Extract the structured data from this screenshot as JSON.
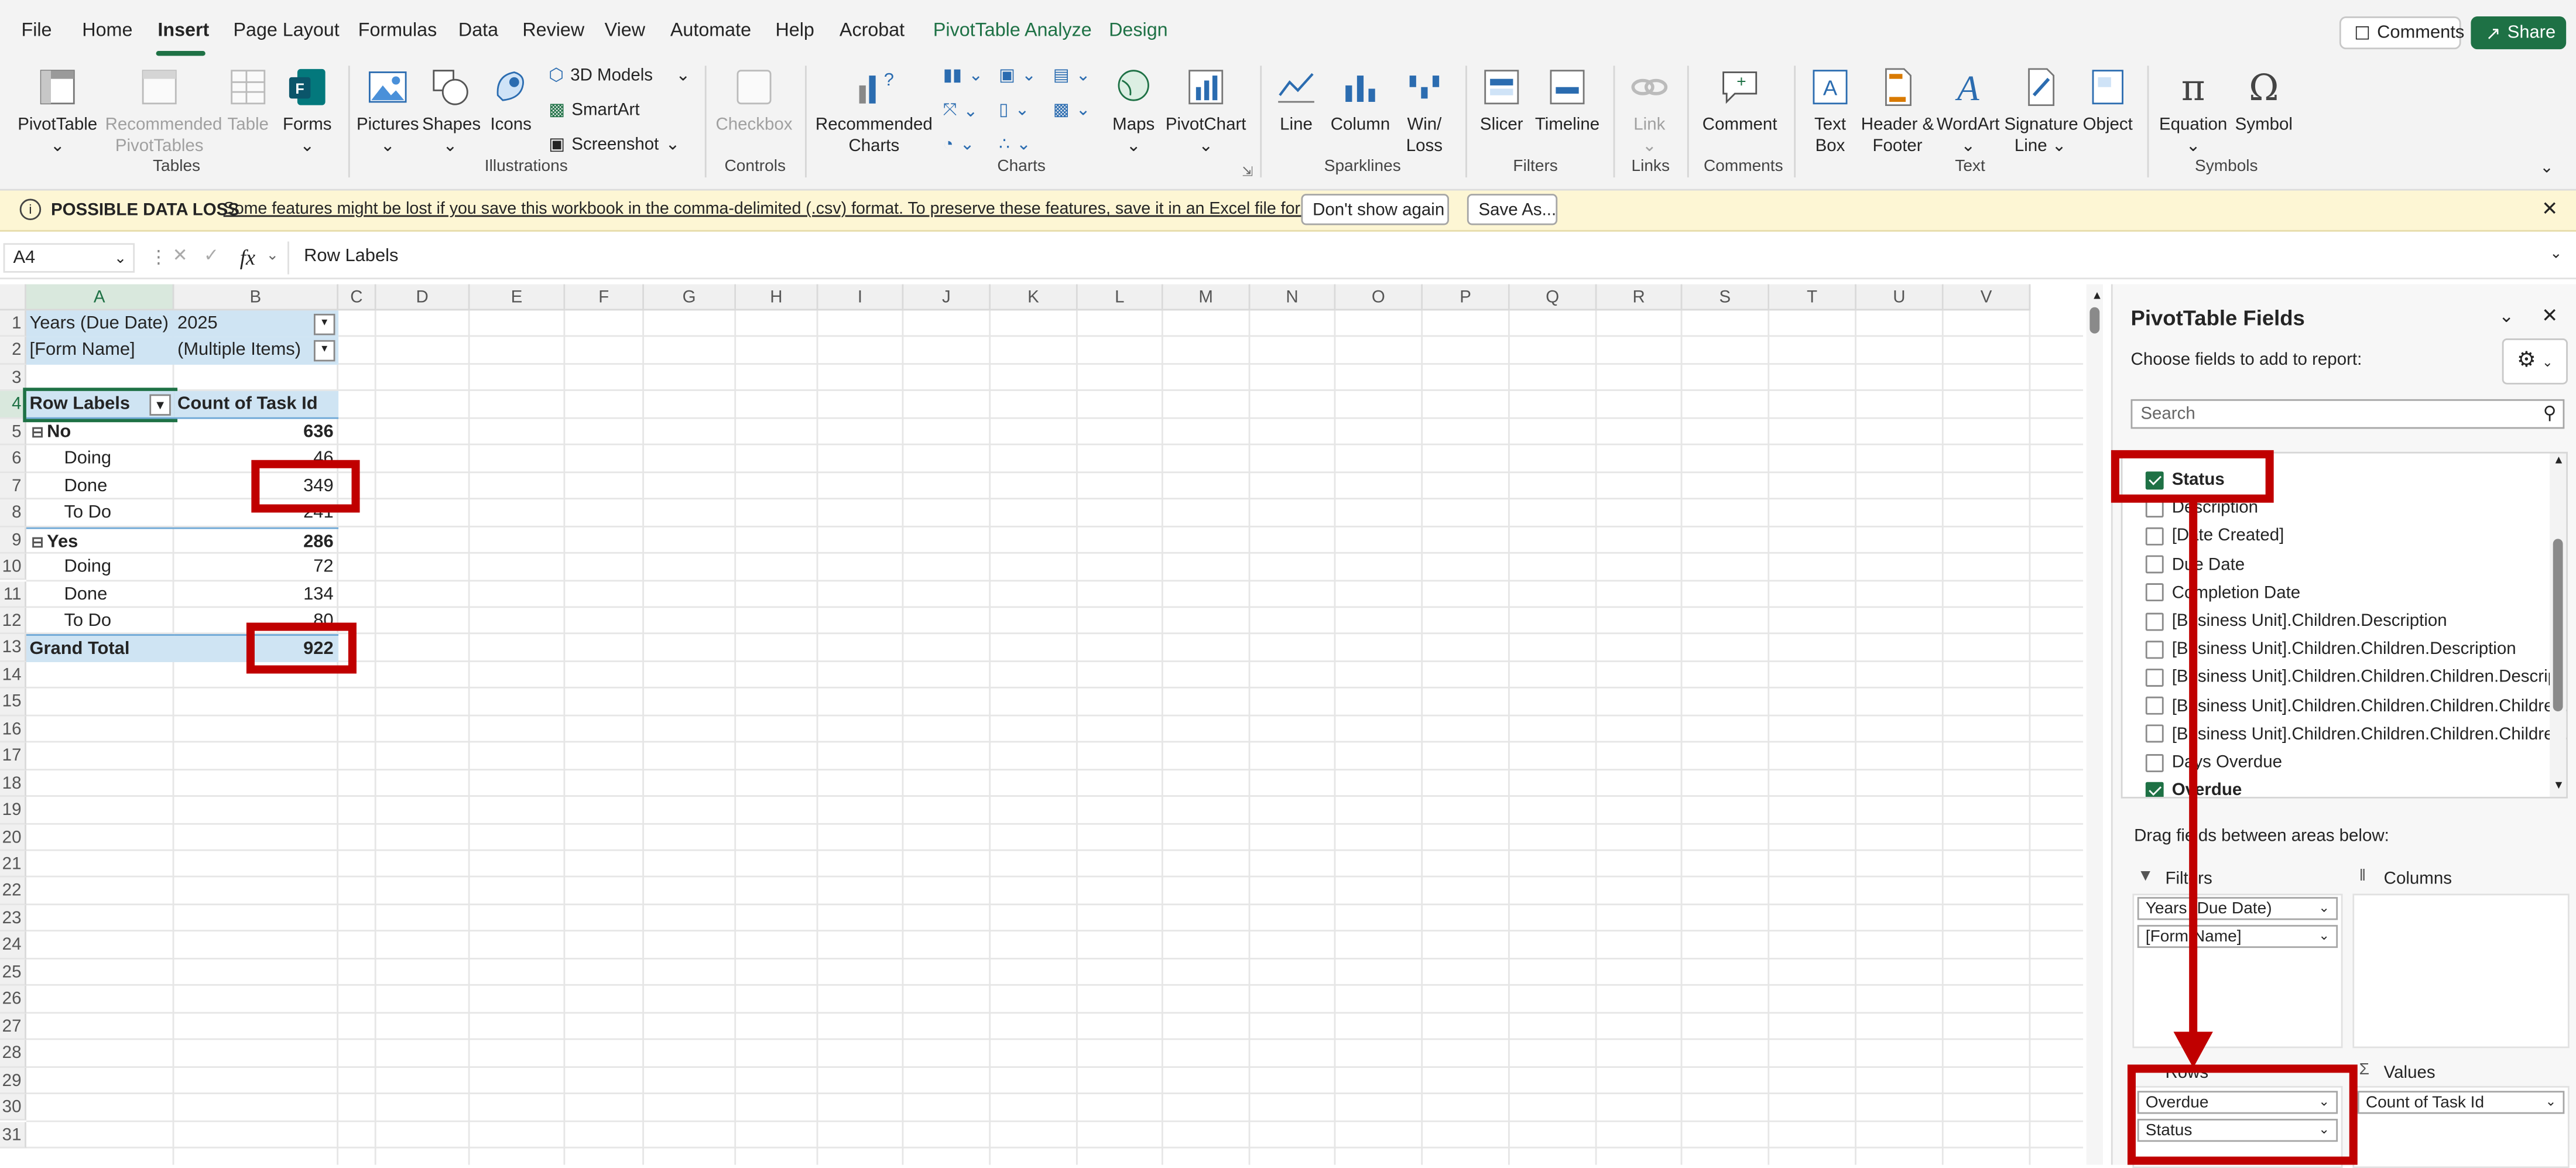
{
  "menu": [
    "File",
    "Home",
    "Insert",
    "Page Layout",
    "Formulas",
    "Data",
    "Review",
    "View",
    "Automate",
    "Help",
    "Acrobat",
    "PivotTable Analyze",
    "Design"
  ],
  "topright": {
    "comments": "Comments",
    "share": "Share"
  },
  "ribbon": {
    "pivottable": "PivotTable",
    "recommended_pivottables": "Recommended PivotTables",
    "table": "Table",
    "forms": "Forms",
    "pictures": "Pictures",
    "shapes": "Shapes",
    "icons": "Icons",
    "models3d": "3D Models",
    "smartart": "SmartArt",
    "screenshot": "Screenshot",
    "checkbox": "Checkbox",
    "recommended_charts": "Recommended Charts",
    "maps": "Maps",
    "pivotchart": "PivotChart",
    "line": "Line",
    "column": "Column",
    "winloss": "Win/ Loss",
    "slicer": "Slicer",
    "timeline": "Timeline",
    "link": "Link",
    "comment": "Comment",
    "textbox": "Text Box",
    "headerfooter": "Header & Footer",
    "wordart": "WordArt",
    "signatureline": "Signature Line",
    "object": "Object",
    "equation": "Equation",
    "symbol": "Symbol",
    "groups": {
      "tables": "Tables",
      "illustrations": "Illustrations",
      "controls": "Controls",
      "charts": "Charts",
      "sparklines": "Sparklines",
      "filters": "Filters",
      "links": "Links",
      "comments": "Comments",
      "text": "Text",
      "symbols": "Symbols"
    }
  },
  "infobar": {
    "title": "POSSIBLE DATA LOSS",
    "message": "Some features might be lost if you save this workbook in the comma-delimited (.csv) format. To preserve these features, save it in an Excel file format.",
    "dont_show": "Don't show again",
    "save_as": "Save As..."
  },
  "formula": {
    "namebox": "A4",
    "fx": "fx",
    "content": "Row Labels"
  },
  "columns": [
    "A",
    "B",
    "C",
    "D",
    "E",
    "F",
    "G",
    "H",
    "I",
    "J",
    "K",
    "L",
    "M",
    "N",
    "O",
    "P",
    "Q",
    "R",
    "S",
    "T",
    "U",
    "V"
  ],
  "rows": [
    "1",
    "2",
    "3",
    "4",
    "5",
    "6",
    "7",
    "8",
    "9",
    "10",
    "11",
    "12",
    "13",
    "14",
    "15",
    "16",
    "17",
    "18",
    "19",
    "20",
    "21",
    "22",
    "23",
    "24",
    "25",
    "26",
    "27",
    "28",
    "29",
    "30",
    "31"
  ],
  "sheet": {
    "r1": {
      "a": "Years (Due Date)",
      "b": "2025"
    },
    "r2": {
      "a": "[Form Name]",
      "b": "(Multiple Items)"
    },
    "r4": {
      "a": "Row Labels",
      "b": "Count of Task Id"
    },
    "r5": {
      "a": "No",
      "b": "636"
    },
    "r6": {
      "a": "Doing",
      "b": "46"
    },
    "r7": {
      "a": "Done",
      "b": "349"
    },
    "r8": {
      "a": "To Do",
      "b": "241"
    },
    "r9": {
      "a": "Yes",
      "b": "286"
    },
    "r10": {
      "a": "Doing",
      "b": "72"
    },
    "r11": {
      "a": "Done",
      "b": "134"
    },
    "r12": {
      "a": "To Do",
      "b": "80"
    },
    "r13": {
      "a": "Grand Total",
      "b": "922"
    }
  },
  "pane": {
    "title": "PivotTable Fields",
    "subtitle": "Choose fields to add to report:",
    "search_placeholder": "Search",
    "fields": [
      {
        "label": "Status",
        "checked": true
      },
      {
        "label": "Description",
        "checked": false
      },
      {
        "label": "[Date Created]",
        "checked": false
      },
      {
        "label": "Due Date",
        "checked": false
      },
      {
        "label": "Completion Date",
        "checked": false
      },
      {
        "label": "[Business Unit].Children.Description",
        "checked": false
      },
      {
        "label": "[Business Unit].Children.Children.Description",
        "checked": false
      },
      {
        "label": "[Business Unit].Children.Children.Children.Descript...",
        "checked": false
      },
      {
        "label": "[Business Unit].Children.Children.Children.Childre...",
        "checked": false
      },
      {
        "label": "[Business Unit].Children.Children.Children.Childre...",
        "checked": false
      },
      {
        "label": "Days Overdue",
        "checked": false
      },
      {
        "label": "Overdue",
        "checked": true
      }
    ],
    "drag_hint": "Drag fields between areas below:",
    "filters_label": "Filters",
    "columns_label": "Columns",
    "rows_label": "Rows",
    "values_label": "Values",
    "filter_items": [
      "Years (Due Date)",
      "[Form Name]"
    ],
    "row_items": [
      "Overdue",
      "Status"
    ],
    "value_items": [
      "Count of Task Id"
    ]
  }
}
